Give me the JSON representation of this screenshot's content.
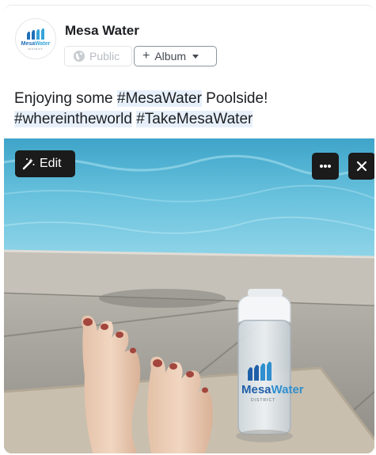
{
  "post": {
    "page_name": "Mesa Water",
    "logo": {
      "word_dark": "Mesa",
      "word_light": "Water",
      "sub": "DISTRICT"
    },
    "audience_label": "Public",
    "album_label": "Album",
    "text_lines": [
      {
        "before": "Enjoying some ",
        "tag": "#MesaWater",
        "after": " Poolside!"
      },
      {
        "tag1": "#whereintheworld",
        "tag2": "#TakeMesaWater"
      }
    ]
  },
  "photo": {
    "edit_label": "Edit",
    "bottle_logo": {
      "word_dark": "Mesa",
      "word_light": "Water",
      "sub": "DISTRICT"
    }
  },
  "icons": {
    "audience": "globe-icon",
    "album_add": "plus-icon",
    "album_menu": "caret-down-icon",
    "edit": "magic-wand-icon",
    "more": "more-icon",
    "close": "close-icon"
  },
  "colors": {
    "brand_blue": "#1f6fb8",
    "brand_light_blue": "#36a4d8",
    "hashtag_highlight": "#e7f0fa",
    "overlay_button": "#1b1b1b"
  }
}
